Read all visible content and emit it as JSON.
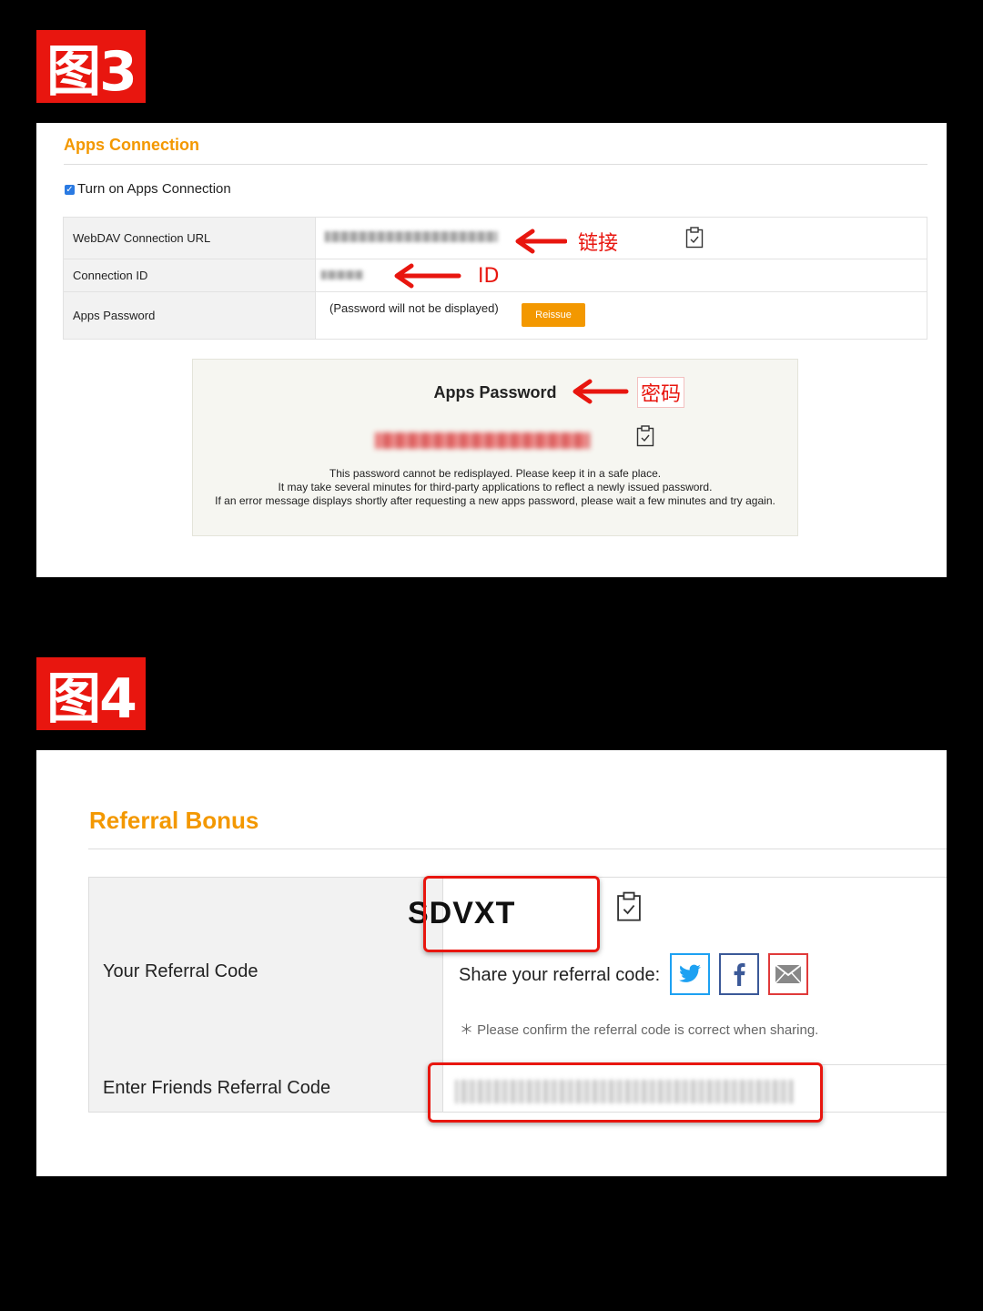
{
  "figure_labels": {
    "fig3": "图3",
    "fig4": "图4"
  },
  "apps": {
    "title": "Apps Connection",
    "checkbox_label": "Turn on Apps Connection",
    "rows": {
      "webdav_label": "WebDAV Connection URL",
      "connection_id_label": "Connection ID",
      "apps_password_label": "Apps Password",
      "password_note": "(Password will not be displayed)",
      "reissue_label": "Reissue"
    },
    "annotations": {
      "link": "链接",
      "id": "ID",
      "password": "密码"
    },
    "password_box": {
      "title": "Apps Password",
      "note_line1": "This password cannot be redisplayed. Please keep it in a safe place.",
      "note_line2": "It may take several minutes for third-party applications to reflect a newly issued password.",
      "note_line3": "If an error message displays shortly after requesting a new apps password, please wait a few minutes and try again."
    }
  },
  "referral": {
    "title": "Referral Bonus",
    "your_code_label": "Your Referral Code",
    "code": "SDVXT",
    "share_label": "Share your referral code:",
    "confirm_note": "＊ Please confirm the referral code is correct when sharing.",
    "enter_label": "Enter Friends Referral Code"
  },
  "colors": {
    "accent": "#f39800",
    "annotation_red": "#e8160f",
    "twitter": "#1da1f2",
    "facebook": "#3b5998",
    "mail": "#e03a3a"
  },
  "icons": [
    "clipboard-check-icon",
    "twitter-icon",
    "facebook-icon",
    "mail-icon",
    "red-arrow-icon",
    "checkbox-checked-icon"
  ]
}
